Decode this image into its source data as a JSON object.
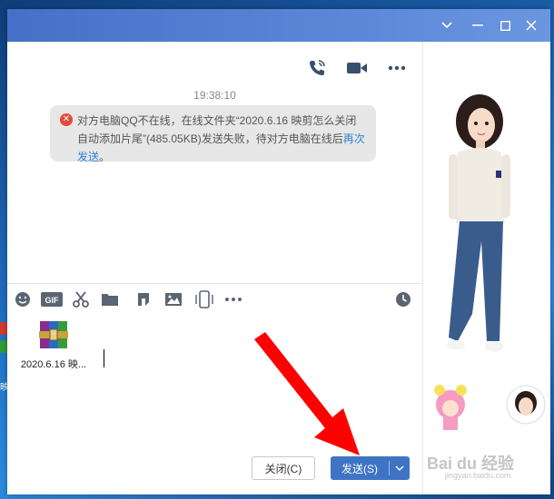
{
  "window": {
    "controls": [
      "chevron-down",
      "minimize",
      "maximize",
      "close"
    ]
  },
  "chat": {
    "timestamp": "19:38:10",
    "notice_text": "对方电脑QQ不在线，在线文件夹“2020.6.16 映剪怎么关闭自动添加片尾”(485.05KB)发送失败，待对方电脑在线后",
    "notice_link": "再次发送",
    "notice_end": "。",
    "header_icons": [
      "phone-icon",
      "video-icon",
      "more-icon"
    ]
  },
  "toolbar": {
    "icons": [
      "emoji-icon",
      "gif-icon",
      "scissors-icon",
      "folder-icon",
      "music-icon",
      "image-icon",
      "phone-screen-icon",
      "more-icon",
      "history-icon"
    ],
    "gif_label": "GIF"
  },
  "input": {
    "file_name": "2020.6.16 映..."
  },
  "buttons": {
    "close_label": "关闭(C)",
    "send_label": "发送(S)"
  },
  "desktop": {
    "label": "映"
  },
  "watermark": {
    "brand": "Bai du 经验",
    "url": "jingyan.baidu.com"
  }
}
